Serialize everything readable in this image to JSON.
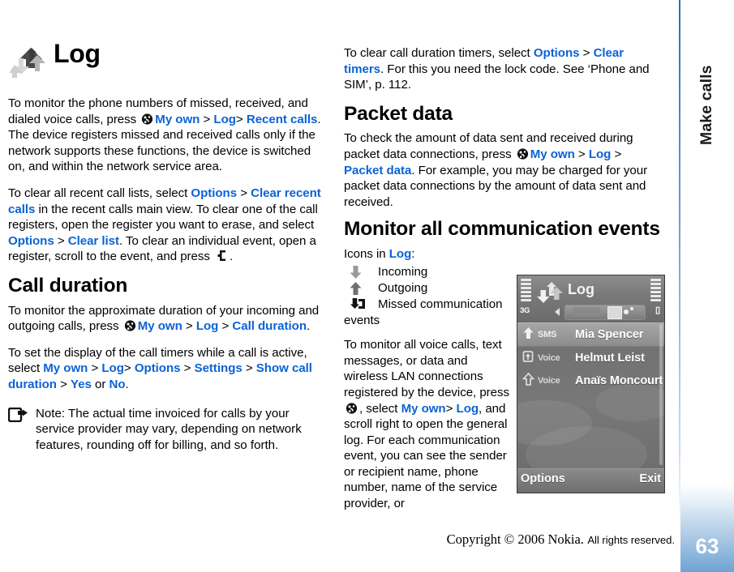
{
  "sidebar": {
    "chapter_label": "Make calls",
    "page_number": "63",
    "accent_color": "#2b6cb8"
  },
  "footer": {
    "copyright": "Copyright © 2006 Nokia.",
    "rights": "All rights reserved."
  },
  "left_column": {
    "title": "Log",
    "p1": {
      "a": "To monitor the phone numbers of missed, received, and dialed voice calls, press ",
      "k1": "My own",
      "s1": " > ",
      "k2": "Log",
      "s2": ">",
      "k3": "Recent calls",
      "b": ". The device registers missed and received calls only if the network supports these functions, the device is switched on, and within the network service area."
    },
    "p2": {
      "a": "To clear all recent call lists, select ",
      "k1": "Options",
      "s1": " > ",
      "k2": "Clear recent calls",
      "b": " in the recent calls main view. To clear one of the call registers, open the register you want to erase, and select ",
      "k3": "Options",
      "s2": " > ",
      "k4": "Clear list",
      "c": ". To clear an individual event, open a register, scroll to the event, and press ",
      "d": "."
    },
    "h_call_duration": "Call duration",
    "p3": {
      "a": "To monitor the approximate duration of your incoming and outgoing calls, press ",
      "k1": "My own",
      "s1": " > ",
      "k2": "Log",
      "s2": " > ",
      "k3": "Call duration",
      "b": "."
    },
    "p4": {
      "a": "To set the display of the call timers while a call is active, select ",
      "k1": "My own",
      "s1": " > ",
      "k2": "Log",
      "s2": "> ",
      "k3": "Options",
      "s3": " > ",
      "k4": "Settings",
      "s4": " > ",
      "k5": "Show call duration",
      "s5": " > ",
      "k6": "Yes",
      "s6": " or ",
      "k7": "No",
      "b": "."
    },
    "note": "Note: The actual time invoiced for calls by your service provider may vary, depending on network features, rounding off for billing, and so forth."
  },
  "right_column": {
    "p1": {
      "a": "To clear call duration timers, select ",
      "k1": "Options",
      "s1": " > ",
      "k2": "Clear timers",
      "b": ". For this you need the lock code. See ‘Phone and SIM’, p. 112."
    },
    "h_packet_data": "Packet data",
    "p2": {
      "a": "To check the amount of data sent and received during packet data connections, press ",
      "k1": "My own",
      "s1": " > ",
      "k2": "Log",
      "s2": " > ",
      "k3": "Packet data",
      "b": ". For example, you may be charged for your packet data connections by the amount of data sent and received."
    },
    "h_monitor": "Monitor all communication events",
    "icons_intro": {
      "a": "Icons in ",
      "k1": "Log",
      "b": ":"
    },
    "icon_items": [
      {
        "icon": "arrow-down-icon",
        "label": "Incoming"
      },
      {
        "icon": "arrow-up-icon",
        "label": "Outgoing"
      },
      {
        "icon": "missed-call-icon",
        "label": "Missed communication"
      }
    ],
    "icon_items_tail": "events",
    "p3": {
      "a": "To monitor all voice calls, text messages, or data and wireless LAN connections registered by the device, press ",
      "a2": ", select ",
      "k1": "My own",
      "s1": "> ",
      "k2": "Log",
      "b": ", and scroll right to open the general log. For each communication event, you can see the sender or recipient name, phone number, name of the service provider, or"
    }
  },
  "phone_screenshot": {
    "status_network": "3G",
    "title": "Log",
    "rows": [
      {
        "type": "SMS",
        "name": "Mia Spencer",
        "selected": true,
        "icon": "arrow-up-icon"
      },
      {
        "type": "Voice",
        "name": "Helmut Leist",
        "selected": false,
        "icon": "missed-call-icon"
      },
      {
        "type": "Voice",
        "name": "Anaïs Moncourt",
        "selected": false,
        "icon": "arrow-up-icon"
      }
    ],
    "softkey_left": "Options",
    "softkey_right": "Exit"
  }
}
